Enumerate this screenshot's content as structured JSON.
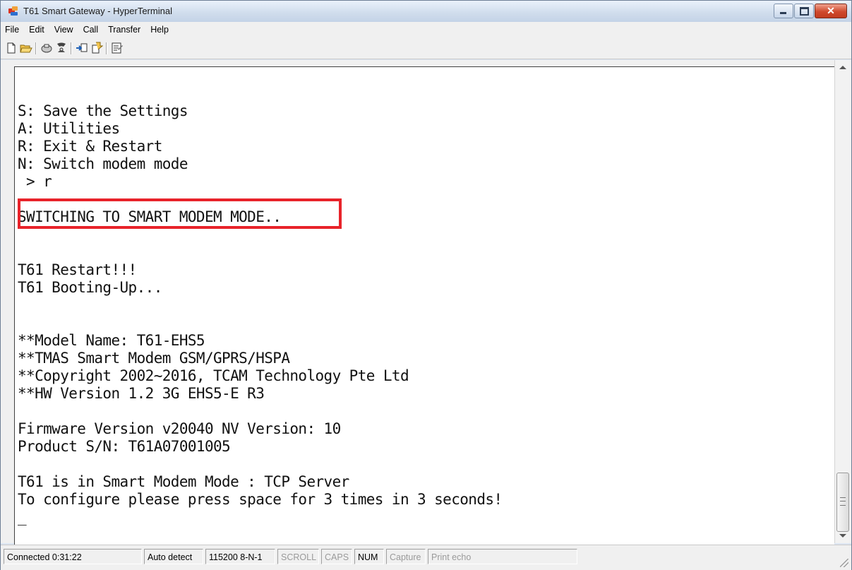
{
  "window": {
    "title": "T61 Smart Gateway - HyperTerminal"
  },
  "menu": [
    "File",
    "Edit",
    "View",
    "Call",
    "Transfer",
    "Help"
  ],
  "toolbar_icons": [
    "new-connection-icon",
    "open-icon",
    "disconnect-icon",
    "dial-icon",
    "send-file-icon",
    "receive-file-icon",
    "properties-icon"
  ],
  "terminal": {
    "lines": [
      "S: Save the Settings",
      "A: Utilities",
      "R: Exit & Restart",
      "N: Switch modem mode",
      " > r",
      "",
      "SWITCHING TO SMART MODEM MODE..",
      "",
      "",
      "T61 Restart!!!",
      "T61 Booting-Up...",
      "",
      "",
      "**Model Name: T61-EHS5",
      "**TMAS Smart Modem GSM/GPRS/HSPA",
      "**Copyright 2002~2016, TCAM Technology Pte Ltd",
      "**HW Version 1.2 3G EHS5-E R3",
      "",
      "Firmware Version v20040 NV Version: 10",
      "Product S/N: T61A07001005",
      "",
      "T61 is in Smart Modem Mode : TCP Server",
      "To configure please press space for 3 times in 3 seconds!"
    ],
    "cursor": "_"
  },
  "status": {
    "connected": "Connected 0:31:22",
    "detect": "Auto detect",
    "port": "115200 8-N-1",
    "scroll": "SCROLL",
    "caps": "CAPS",
    "num": "NUM",
    "capture": "Capture",
    "print_echo": "Print echo"
  },
  "colors": {
    "highlight_box": "#e8232a",
    "close_button": "#c94a33"
  }
}
